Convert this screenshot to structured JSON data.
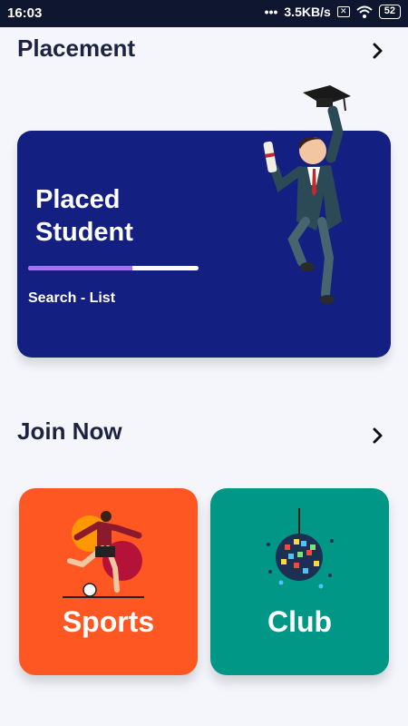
{
  "status_bar": {
    "time": "16:03",
    "network_speed": "3.5KB/s",
    "battery": "52"
  },
  "placement": {
    "section_title": "Placement",
    "card_title": "Placed Student",
    "progress_percent": 61,
    "link_text": "Search - List"
  },
  "join": {
    "section_title": "Join Now",
    "cards": [
      {
        "label": "Sports",
        "color": "#ff5722"
      },
      {
        "label": "Club",
        "color": "#009787"
      }
    ]
  },
  "colors": {
    "placement_card": "#141f82",
    "progress_fill": "#b46af2",
    "text_dark": "#1b2340"
  }
}
